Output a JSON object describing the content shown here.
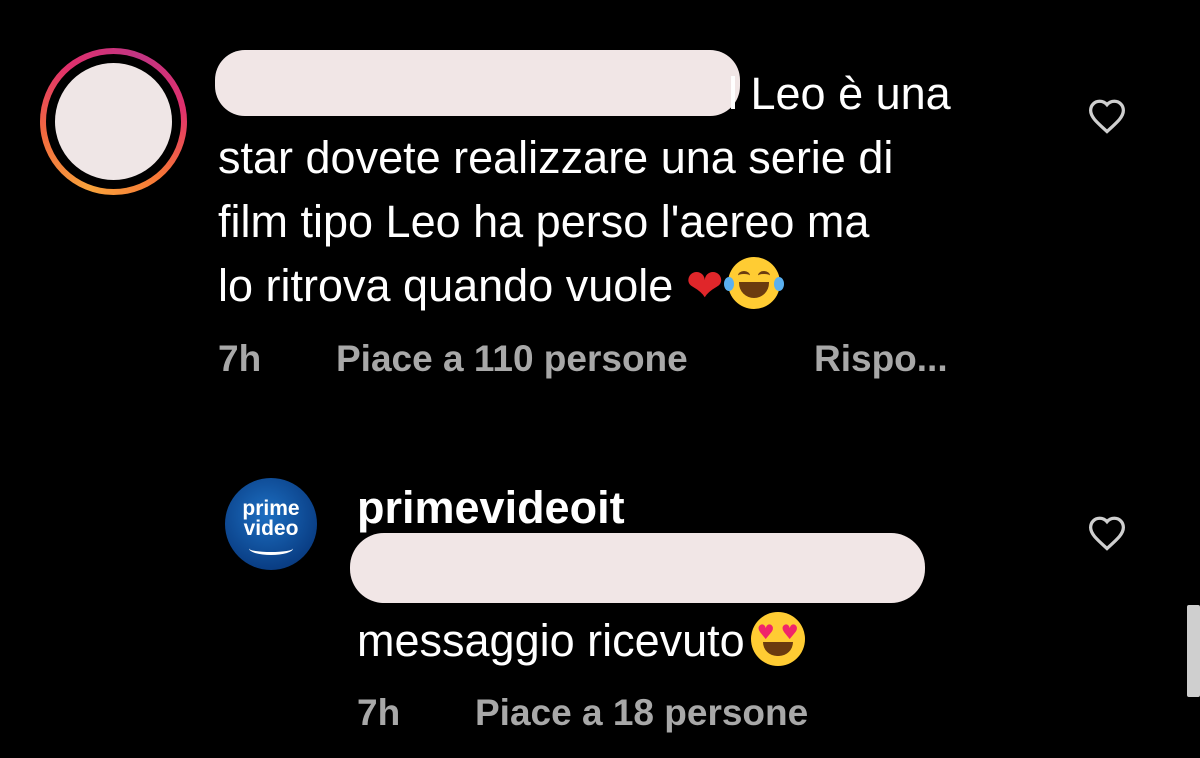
{
  "comments": [
    {
      "username_redacted": true,
      "text_lines": [
        "l Leo è una",
        "star dovete realizzare una serie di",
        "film tipo Leo ha perso l'aereo ma",
        "lo ritrova quando vuole"
      ],
      "emojis": [
        "red-heart",
        "face-with-tears-of-joy"
      ],
      "time": "7h",
      "likes": "Piace a 110 persone",
      "reply_label": "Rispo..."
    },
    {
      "username": "primevideoit",
      "avatar_text": [
        "prime",
        "video"
      ],
      "text_redacted": true,
      "text": "messaggio ricevuto",
      "emojis": [
        "smiling-face-with-heart-eyes"
      ],
      "time": "7h",
      "likes": "Piace a 18 persone"
    }
  ],
  "colors": {
    "background": "#000000",
    "text": "#ffffff",
    "meta_text": "#a8a8a8",
    "redaction": "#f1e6e6",
    "prime_blue": "#0a3f86"
  },
  "icons": [
    "heart-outline-icon",
    "heart-outline-icon"
  ]
}
